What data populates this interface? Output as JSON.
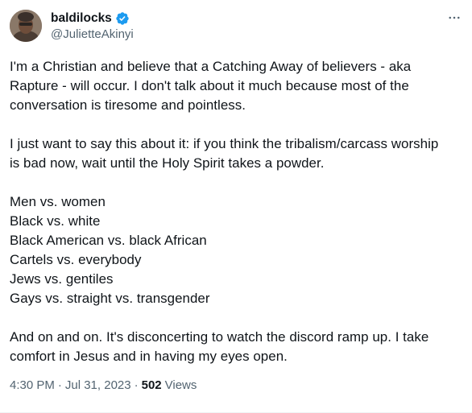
{
  "author": {
    "display_name": "baldilocks",
    "handle": "@JulietteAkinyi",
    "verified": true
  },
  "icons": {
    "verified": "verified-badge-icon",
    "more": "more-options-icon",
    "avatar": "profile-avatar"
  },
  "colors": {
    "verified_badge": "#1d9bf0",
    "secondary_text": "#536471",
    "primary_text": "#0f1419"
  },
  "tweet": {
    "paragraphs": [
      [
        "I'm a Christian and believe that a Catching Away of believers - aka",
        "Rapture - will occur. I don't talk about it much because most of the",
        "conversation is tiresome and pointless."
      ],
      [
        "I just want to say this about it: if you think the tribalism/carcass worship",
        "is bad now, wait until the Holy Spirit takes a powder."
      ],
      [
        "Men vs. women",
        "Black vs. white",
        "Black American vs. black African",
        "Cartels vs. everybody",
        "Jews vs. gentiles",
        "Gays vs. straight vs. transgender"
      ],
      [
        "And on and on. It's disconcerting to watch the discord ramp up. I take",
        "comfort in Jesus and in having my eyes open."
      ]
    ],
    "time": "4:30 PM",
    "separator": "·",
    "date": "Jul 31, 2023",
    "separator2": "·",
    "views_count": "502",
    "views_label": "Views"
  }
}
